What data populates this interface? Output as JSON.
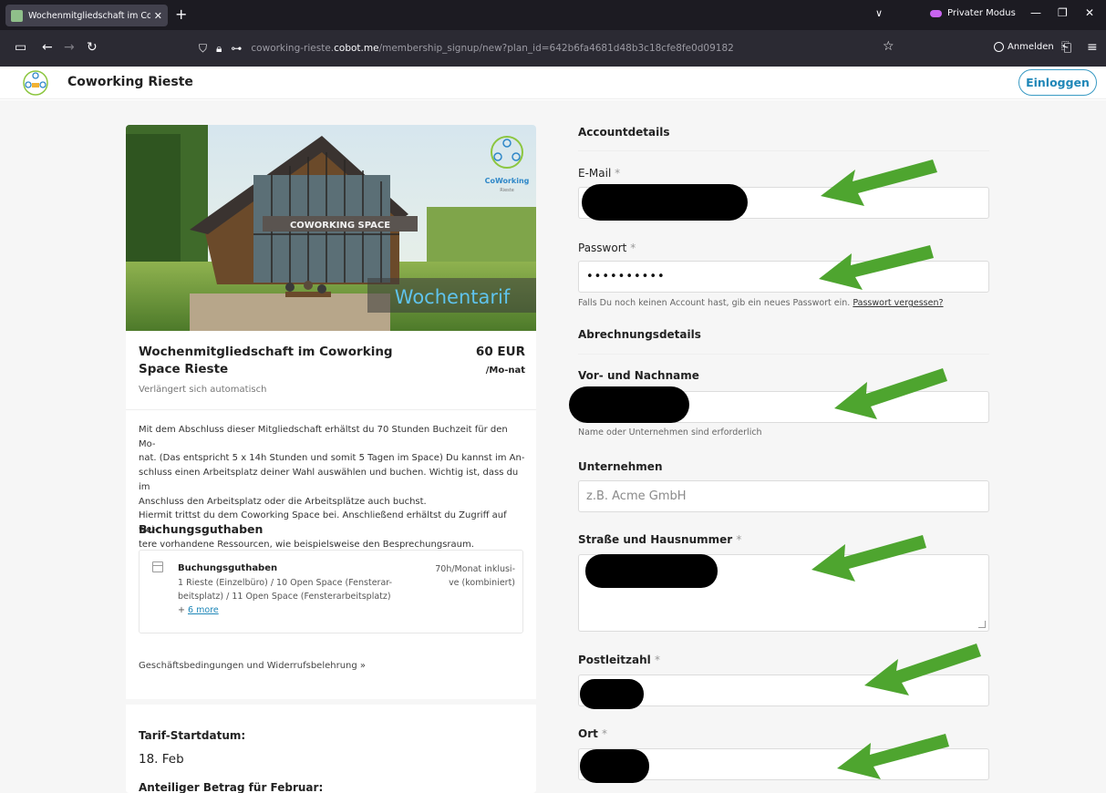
{
  "browser": {
    "tab_title": "Wochenmitgliedschaft im Cowo",
    "private_label": "Privater Modus",
    "url_pre": "coworking-rieste.",
    "url_host": "cobot.me",
    "url_path": "/membership_signup/new?plan_id=642b6fa4681d48b3c18cfe8fe0d09182",
    "signin_label": "Anmelden"
  },
  "header": {
    "site_name": "Coworking Rieste",
    "login_label": "Einloggen"
  },
  "plan": {
    "hero_text": "Wochentarif",
    "building_sign": "COWORKING SPACE",
    "logo_text": "CoWorking",
    "logo_sub": "Rieste",
    "title": "Wochenmitgliedschaft im Coworking Space Rieste",
    "price": "60 EUR",
    "price_unit": "/Mo-nat",
    "renews": "Verlängert sich automatisch",
    "description_lines": [
      "Mit dem Abschluss dieser Mitgliedschaft erhältst du 70 Stunden Buchzeit für den Mo-",
      "nat. (Das entspricht 5 x 14h Stunden und somit 5 Tagen im Space) Du kannst im An-",
      "schluss einen Arbeitsplatz deiner Wahl auswählen und buchen. Wichtig ist, dass du im",
      "Anschluss den Arbeitsplatz oder die Arbeitsplätze auch buchst.",
      "Hiermit trittst du dem Coworking Space bei. Anschließend erhältst du Zugriff auf wei-",
      "tere vorhandene Ressourcen, wie beispielsweise den Besprechungsraum."
    ],
    "credits_heading": "Buchungsguthaben",
    "credit_name": "Buchungsguthaben",
    "credit_rooms_lines": [
      "1 Rieste (Einzelbüro) / 10 Open Space (Fensterar-",
      "beitsplatz) / 11 Open Space (Fensterarbeitsplatz)"
    ],
    "credit_more_prefix": "+",
    "credit_more_link": "6 more",
    "credit_amount_lines": [
      "70h/Monat inklusi-",
      "ve (kombiniert)"
    ],
    "terms_link": "Geschäftsbedingungen und Widerrufsbelehrung »",
    "start_label": "Tarif-Startdatum:",
    "start_date": "18. Feb",
    "prorata_label": "Anteiliger Betrag für Februar:"
  },
  "form": {
    "account_heading": "Accountdetails",
    "email_label": "E-Mail",
    "password_label": "Passwort",
    "password_mask": "••••••••••",
    "password_hint": "Falls Du noch keinen Account hast, gib ein neues Passwort ein.",
    "forgot_link": "Passwort vergessen?",
    "billing_heading": "Abrechnungsdetails",
    "name_label": "Vor- und Nachname",
    "name_hint": "Name oder Unternehmen sind erforderlich",
    "company_label": "Unternehmen",
    "company_placeholder": "z.B. Acme GmbH",
    "street_label": "Straße und Hausnummer",
    "zip_label": "Postleitzahl",
    "city_label": "Ort",
    "required_mark": "*"
  },
  "colors": {
    "accent": "#1f87b8",
    "annotation_arrow": "#4ea52f",
    "redaction": "#000000"
  },
  "icons": [
    "new-tab-icon",
    "back-icon",
    "forward-icon",
    "reload-icon",
    "shield-icon",
    "lock-icon",
    "permissions-icon",
    "bookmark-star-icon",
    "account-icon",
    "share-icon",
    "menu-icon",
    "calendar-icon"
  ]
}
